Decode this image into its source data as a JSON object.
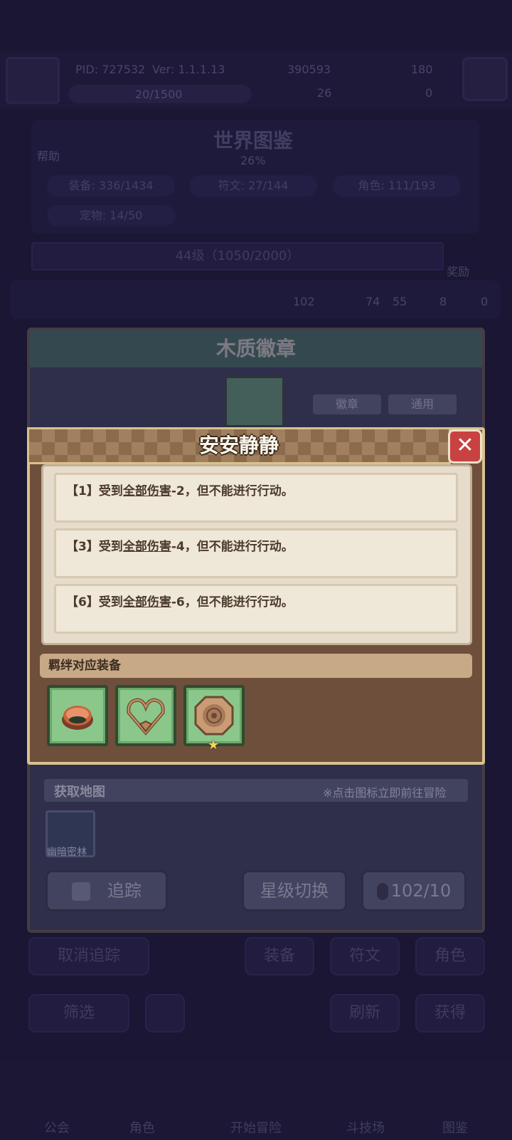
{
  "header": {
    "pid": "PID: 727532",
    "ver": "Ver: 1.1.1.13",
    "coins": "390593",
    "gems": "180",
    "exp": "20/1500",
    "clover": "26",
    "keys": "0"
  },
  "codex": {
    "help_label": "帮助",
    "title": "世界图鉴",
    "percent": "26%",
    "stats": [
      "装备: 336/1434",
      "符文: 27/144",
      "角色: 111/193",
      "宠物: 14/50"
    ],
    "level": "44级（1050/2000）",
    "reward_label": "奖励",
    "counts": [
      "102",
      "74",
      "55",
      "8",
      "0"
    ]
  },
  "item": {
    "name": "木质徽章",
    "tags": [
      "徽章",
      "通用"
    ],
    "map_header": "获取地图",
    "map_hint": "※点击图标立即前往冒险",
    "map_name": "幽暗密林",
    "track_label": "追踪",
    "star_switch_label": "星级切换",
    "cost": "102/10"
  },
  "popup": {
    "title": "安安静静",
    "close_icon": "close-icon",
    "effects": [
      {
        "prefix": "【1】受到",
        "link": "全部伤害",
        "suffix": "-2，但不能进行行动。"
      },
      {
        "prefix": "【3】受到",
        "link": "全部伤害",
        "suffix": "-4，但不能进行行动。"
      },
      {
        "prefix": "【6】受到",
        "link": "全部伤害",
        "suffix": "-6，但不能进行行动。"
      }
    ],
    "bond_section": "羁绊对应装备",
    "bond_equipment": [
      "ring-icon",
      "heart-necklace-icon",
      "wooden-badge-icon"
    ]
  },
  "bottom": {
    "untrack_label": "取消追踪",
    "equip_tab": "装备",
    "rune_tab": "符文",
    "role_tab": "角色",
    "filter_label": "筛选",
    "unk1": "刷新",
    "unk2": "获得"
  },
  "nav": [
    "公会",
    "角色",
    "开始冒险",
    "斗技场",
    "图鉴"
  ]
}
